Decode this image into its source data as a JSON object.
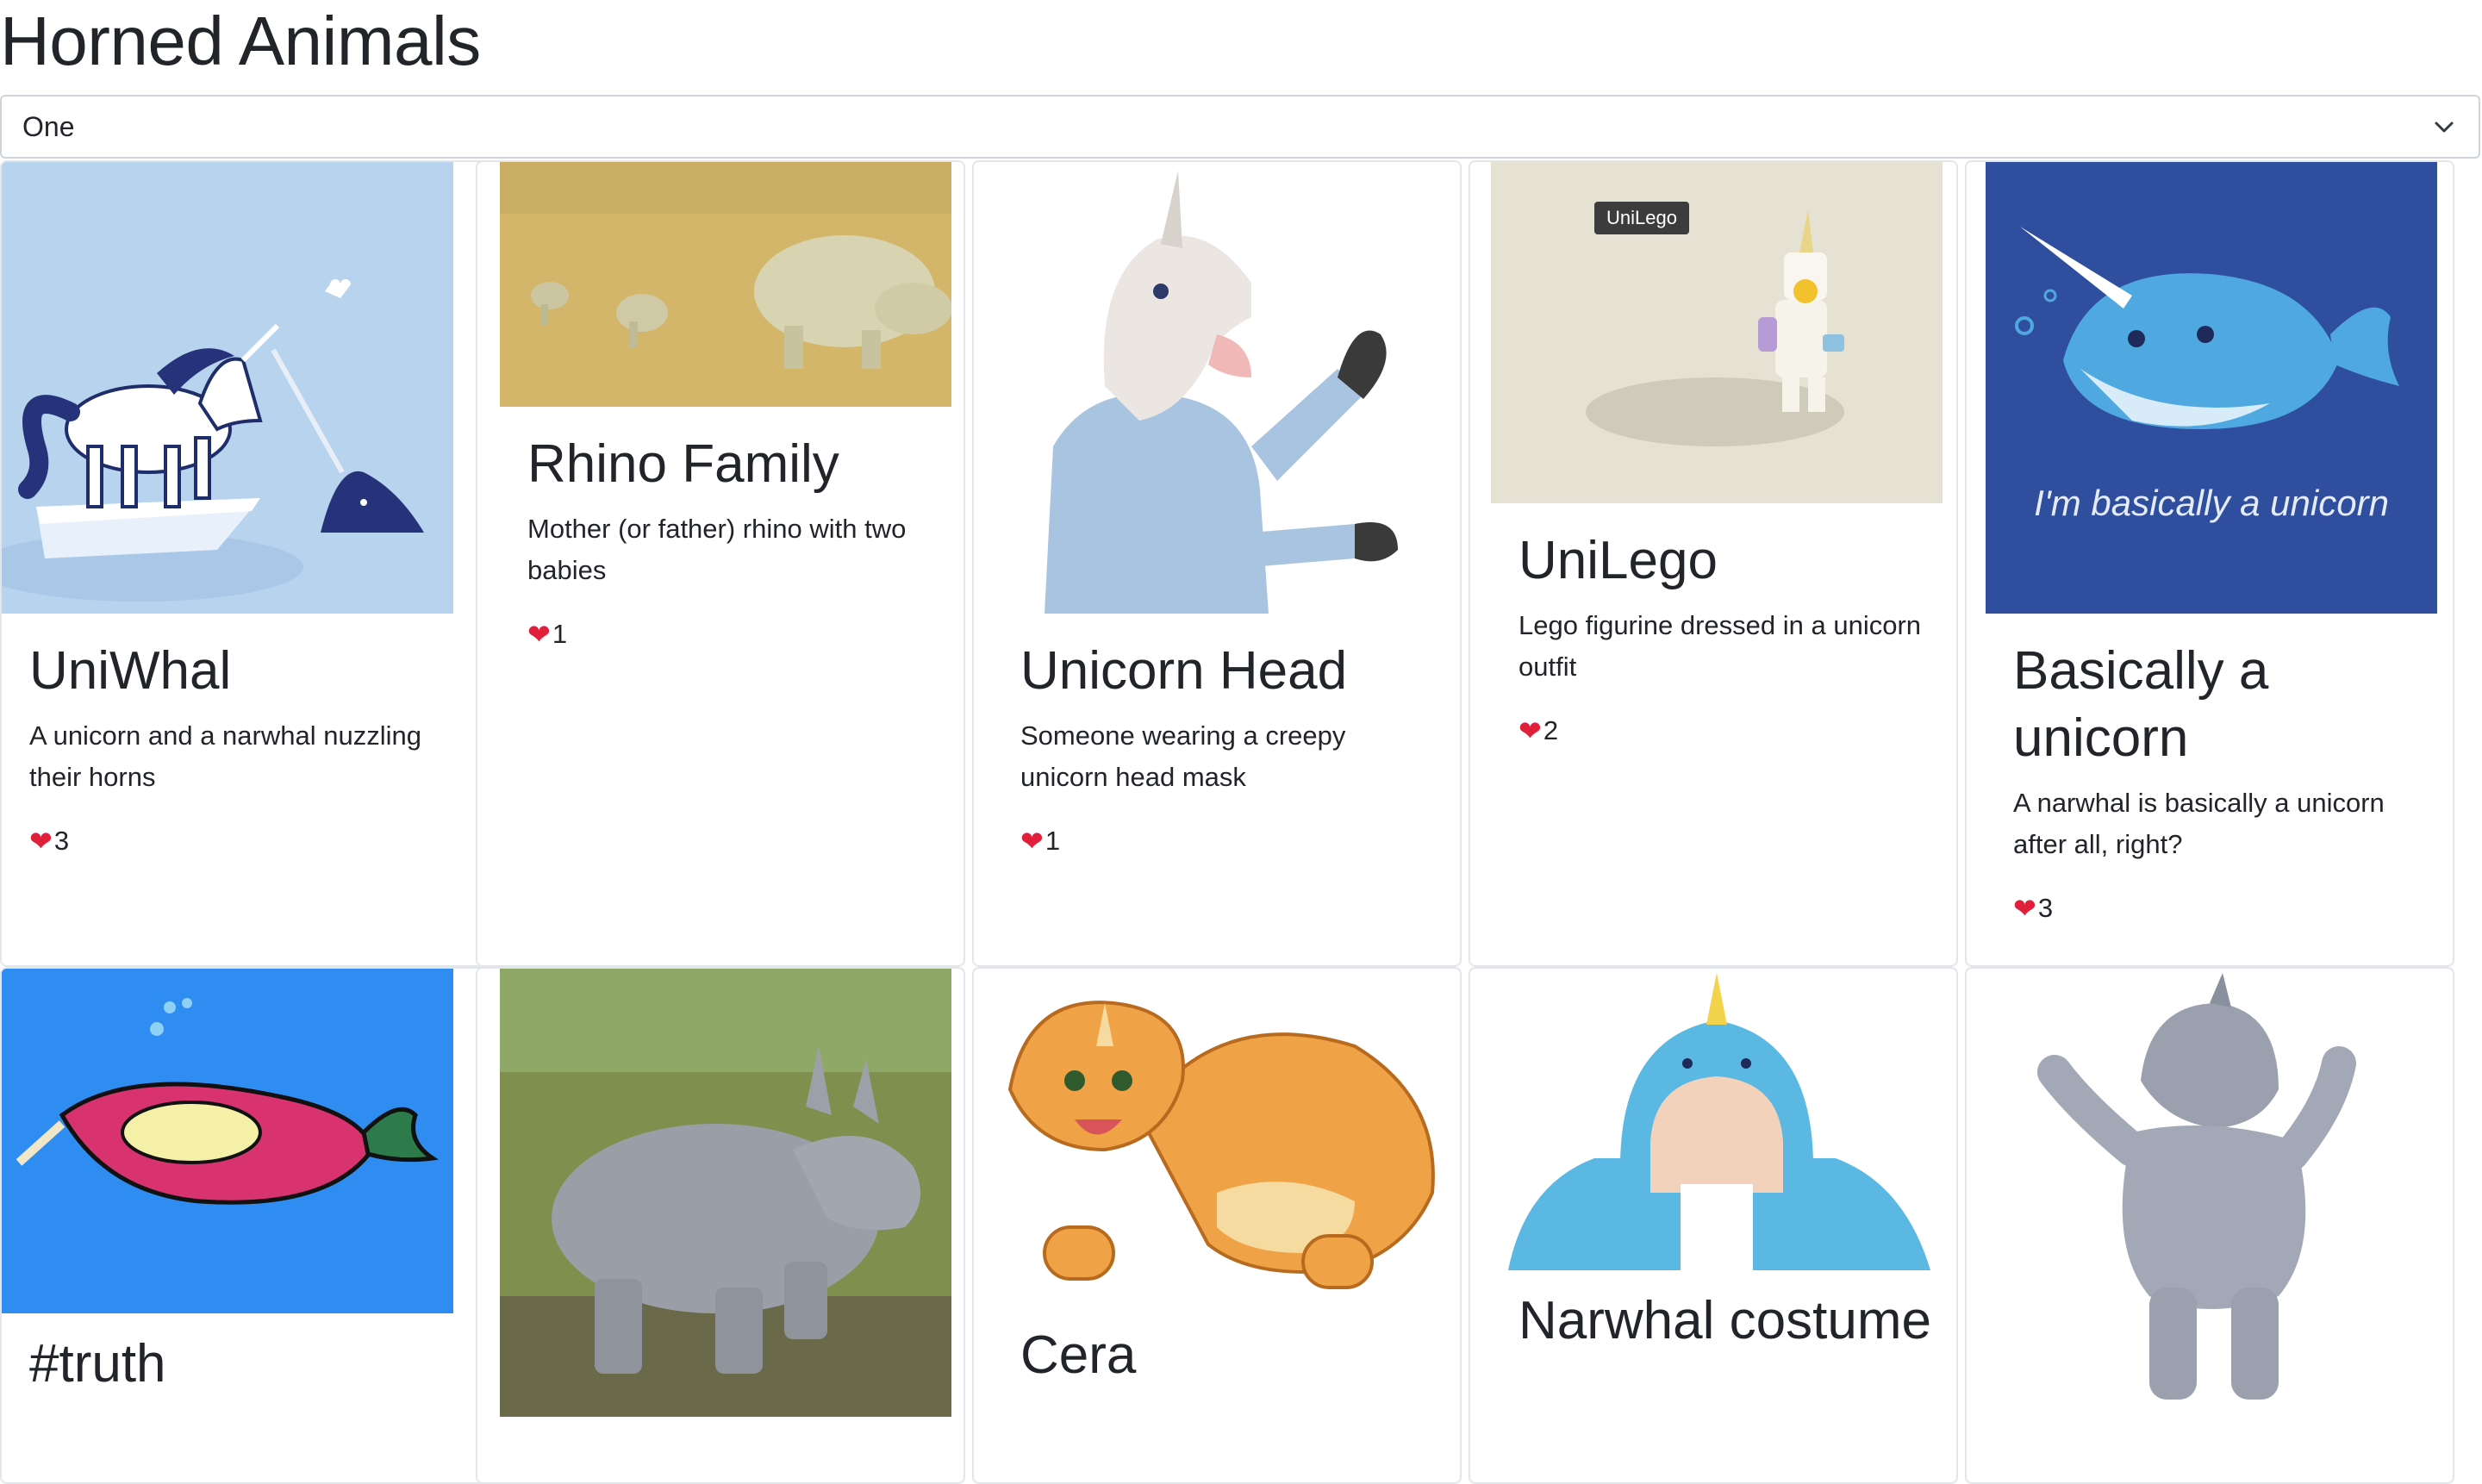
{
  "header": {
    "title": "Horned Animals"
  },
  "filter": {
    "selected": "One"
  },
  "like_icon": "heart-icon",
  "tooltip": "UniLego",
  "cards": [
    {
      "title": "UniWhal",
      "description": "A unicorn and a narwhal nuzzling their horns",
      "likes": "3"
    },
    {
      "title": "Rhino Family",
      "description": "Mother (or father) rhino with two babies",
      "likes": "1"
    },
    {
      "title": "Unicorn Head",
      "description": "Someone wearing a creepy unicorn head mask",
      "likes": "1"
    },
    {
      "title": "UniLego",
      "description": "Lego figurine dressed in a unicorn outfit",
      "likes": "2"
    },
    {
      "title": "Basically a unicorn",
      "description": "A narwhal is basically a unicorn after all, right?",
      "likes": "3"
    },
    {
      "title": "#truth"
    },
    {
      "title": ""
    },
    {
      "title": "Cera"
    },
    {
      "title": "Narwhal costume"
    },
    {
      "title": ""
    }
  ],
  "image_text": {
    "narwhal_shirt": "I'm basically a unicorn"
  }
}
